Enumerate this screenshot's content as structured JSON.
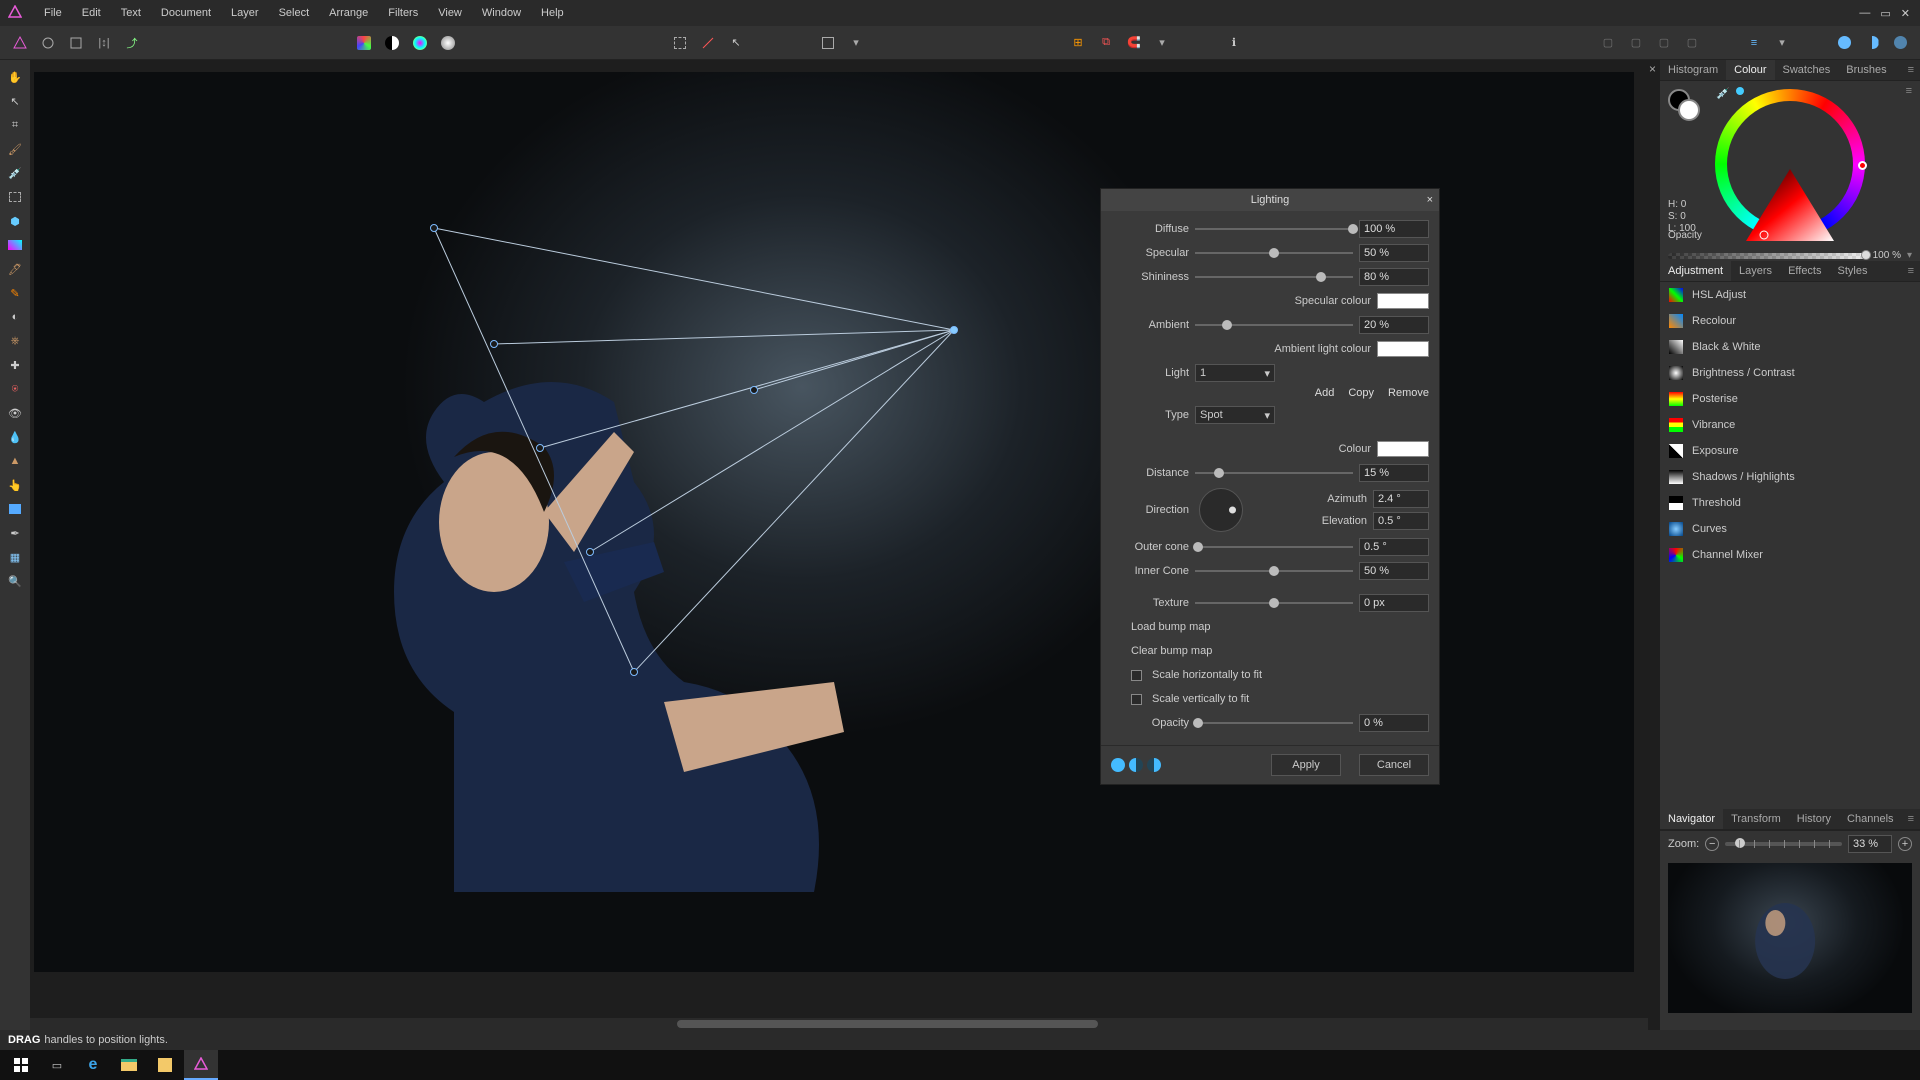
{
  "menu": {
    "items": [
      "File",
      "Edit",
      "Text",
      "Document",
      "Layer",
      "Select",
      "Arrange",
      "Filters",
      "View",
      "Window",
      "Help"
    ]
  },
  "panels": {
    "top_tabs": [
      "Histogram",
      "Colour",
      "Swatches",
      "Brushes"
    ],
    "top_active": "Colour",
    "hsl": {
      "h": "H: 0",
      "s": "S: 0",
      "l": "L: 100"
    },
    "opacity_label": "Opacity",
    "opacity_value": "100 %",
    "mid_tabs": [
      "Adjustment",
      "Layers",
      "Effects",
      "Styles"
    ],
    "mid_active": "Adjustment",
    "adjustments": [
      "HSL Adjust",
      "Recolour",
      "Black & White",
      "Brightness / Contrast",
      "Posterise",
      "Vibrance",
      "Exposure",
      "Shadows / Highlights",
      "Threshold",
      "Curves",
      "Channel Mixer"
    ],
    "bottom_tabs": [
      "Navigator",
      "Transform",
      "History",
      "Channels"
    ],
    "bottom_active": "Navigator",
    "zoom_label": "Zoom:",
    "zoom_value": "33 %"
  },
  "dialog": {
    "title": "Lighting",
    "diffuse": {
      "label": "Diffuse",
      "value": "100 %",
      "pos": 100
    },
    "specular": {
      "label": "Specular",
      "value": "50 %",
      "pos": 50
    },
    "shininess": {
      "label": "Shininess",
      "value": "80 %",
      "pos": 80
    },
    "specular_colour_label": "Specular colour",
    "ambient": {
      "label": "Ambient",
      "value": "20 %",
      "pos": 20
    },
    "ambient_colour_label": "Ambient light colour",
    "light_label": "Light",
    "light_value": "1",
    "links": [
      "Add",
      "Copy",
      "Remove"
    ],
    "type_label": "Type",
    "type_value": "Spot",
    "colour_label": "Colour",
    "distance": {
      "label": "Distance",
      "value": "15 %",
      "pos": 15
    },
    "direction_label": "Direction",
    "azimuth_label": "Azimuth",
    "azimuth_value": "2.4 °",
    "elevation_label": "Elevation",
    "elevation_value": "0.5 °",
    "outer_cone": {
      "label": "Outer cone",
      "value": "0.5 °",
      "pos": 2
    },
    "inner_cone": {
      "label": "Inner Cone",
      "value": "50 %",
      "pos": 50
    },
    "texture": {
      "label": "Texture",
      "value": "0 px",
      "pos": 50
    },
    "load_bump": "Load bump map",
    "clear_bump": "Clear bump map",
    "scale_h": "Scale horizontally to fit",
    "scale_v": "Scale vertically to fit",
    "opacity": {
      "label": "Opacity",
      "value": "0 %",
      "pos": 2
    },
    "apply": "Apply",
    "cancel": "Cancel"
  },
  "status": {
    "bold": "DRAG",
    "rest": "handles to position lights."
  },
  "tools": [
    "hand",
    "move",
    "crop",
    "brush",
    "colour-picker",
    "marquee",
    "flood",
    "gradient",
    "paint",
    "pencil",
    "dodge",
    "clone",
    "patch",
    "inpaint",
    "red-eye",
    "blur",
    "sharpen",
    "smudge",
    "rectangle",
    "pen",
    "mesh",
    "zoom"
  ],
  "adj_colors": [
    "linear-gradient(45deg,#f00,#0f0,#00f)",
    "linear-gradient(45deg,#f80,#08f)",
    "linear-gradient(45deg,#000,#fff)",
    "radial-gradient(#fff,#000)",
    "linear-gradient(#f00,#ff0,#0f0)",
    "linear-gradient(#f00 33%,#ff0 33% 66%,#0f0 66%)",
    "linear-gradient(45deg,#000 50%,#fff 50%)",
    "linear-gradient(#000,#888,#fff)",
    "linear-gradient(#000 50%,#fff 50%)",
    "radial-gradient(#8cf,#048)",
    "conic-gradient(#f00,#0f0,#00f,#f00)"
  ]
}
